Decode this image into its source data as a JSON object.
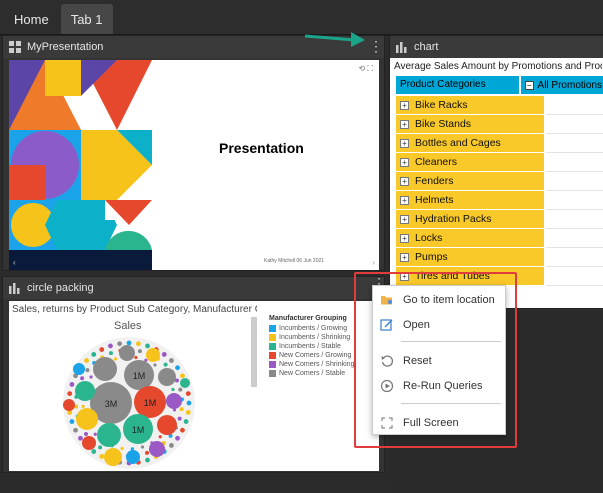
{
  "tabs": [
    "Home",
    "Tab 1"
  ],
  "presentation_panel": {
    "title": "MyPresentation",
    "slide_title": "Presentation",
    "slide_footer": "Kathy Mitchell 06 Jun 2021"
  },
  "chart_panel": {
    "title": "chart",
    "table_title": "Average Sales Amount by Promotions and Product Categories",
    "header_categories": "Product Categories",
    "header_all": "All Promotions",
    "rows": [
      "Bike Racks",
      "Bike Stands",
      "Bottles and Cages",
      "Cleaners",
      "Fenders",
      "Helmets",
      "Hydration Packs",
      "Locks",
      "Pumps",
      "Tires and Tubes"
    ]
  },
  "circle_panel": {
    "title": "circle packing",
    "chart_title": "Sales, returns by Product Sub Category, Manufacturer Grouping",
    "center_label": "Sales",
    "bubble_labels": [
      "3M",
      "1M",
      "1M",
      "1M"
    ],
    "legend_title": "Manufacturer Grouping",
    "legend": [
      {
        "label": "Incumbents / Growing",
        "color": "#1aa3e8"
      },
      {
        "label": "Incumbents / Shrinking",
        "color": "#f6c31a"
      },
      {
        "label": "Incumbents / Stable",
        "color": "#2bb58f"
      },
      {
        "label": "New Comers / Growing",
        "color": "#e5482d"
      },
      {
        "label": "New Comers / Shrinking",
        "color": "#9b59c5"
      },
      {
        "label": "New Comers / Stable",
        "color": "#8a8a8a"
      }
    ]
  },
  "context_menu": {
    "items": [
      {
        "label": "Go to item location",
        "icon": "folder-location-icon"
      },
      {
        "label": "Open",
        "icon": "open-edit-icon"
      },
      {
        "label": "Reset",
        "icon": "reset-icon"
      },
      {
        "label": "Re-Run Queries",
        "icon": "rerun-icon"
      },
      {
        "label": "Full Screen",
        "icon": "fullscreen-icon"
      }
    ]
  },
  "colors": {
    "header_blue": "#00a6d6",
    "category_yellow": "#f9c829",
    "highlight_red": "#e03c3c",
    "arrow_teal": "#1aa58a"
  }
}
